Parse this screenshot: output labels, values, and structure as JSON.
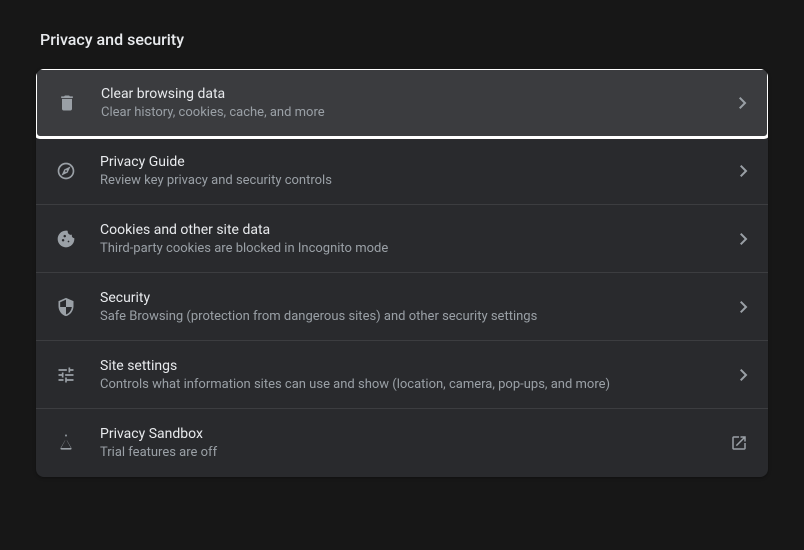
{
  "section_title": "Privacy and security",
  "items": [
    {
      "title": "Clear browsing data",
      "subtitle": "Clear history, cookies, cache, and more"
    },
    {
      "title": "Privacy Guide",
      "subtitle": "Review key privacy and security controls"
    },
    {
      "title": "Cookies and other site data",
      "subtitle": "Third-party cookies are blocked in Incognito mode"
    },
    {
      "title": "Security",
      "subtitle": "Safe Browsing (protection from dangerous sites) and other security settings"
    },
    {
      "title": "Site settings",
      "subtitle": "Controls what information sites can use and show (location, camera, pop-ups, and more)"
    },
    {
      "title": "Privacy Sandbox",
      "subtitle": "Trial features are off"
    }
  ]
}
